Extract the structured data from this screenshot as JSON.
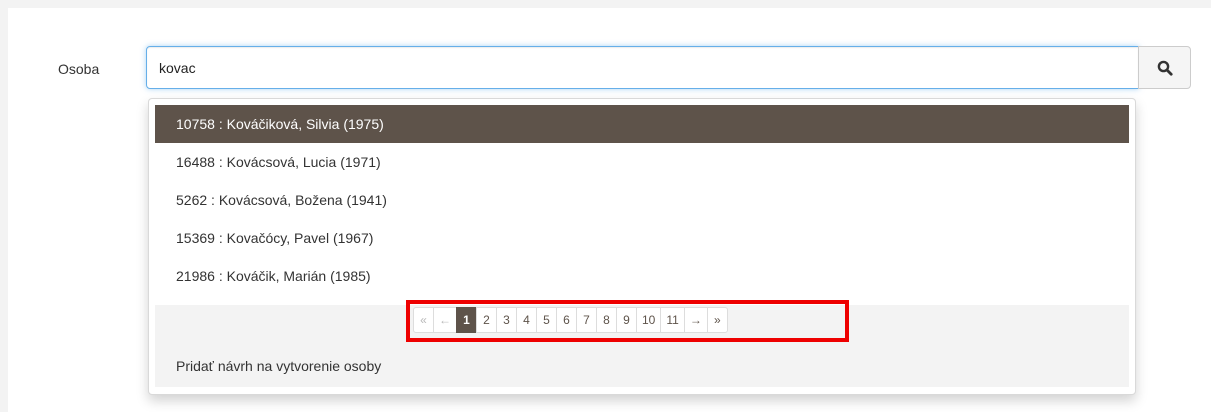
{
  "form": {
    "label": "Osoba",
    "query": "kovac"
  },
  "search_button": {
    "icon": "search-icon"
  },
  "results": [
    {
      "text": "10758 : Kováčiková, Silvia (1975)",
      "active": true
    },
    {
      "text": "16488 : Kovácsová, Lucia (1971)",
      "active": false
    },
    {
      "text": "5262 : Kovácsová, Božena (1941)",
      "active": false
    },
    {
      "text": "15369 : Kovačócy, Pavel (1967)",
      "active": false
    },
    {
      "text": "21986 : Kováčik, Marián (1985)",
      "active": false
    }
  ],
  "pagination": {
    "first": "«",
    "prev": "←",
    "pages": [
      "1",
      "2",
      "3",
      "4",
      "5",
      "6",
      "7",
      "8",
      "9",
      "10",
      "11"
    ],
    "current_page": "1",
    "next": "→",
    "last": "»"
  },
  "add_person_link": "Pridať návrh na vytvorenie osoby",
  "colors": {
    "accent": "#5e534a",
    "highlight_box": "#ee0000",
    "focus_border": "#66afe9"
  }
}
